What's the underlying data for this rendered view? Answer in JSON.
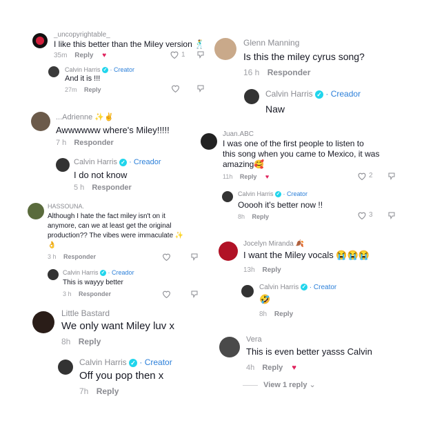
{
  "comments": {
    "c1": {
      "user": "_uncopyrightable_",
      "text": "I like this better than the Miley version",
      "emoji": "🕺",
      "time": "35m",
      "reply": "Reply",
      "likes": "1"
    },
    "c1r": {
      "user": "Calvin Harris",
      "badge": "· Creator",
      "text": "And it is !!!",
      "time": "27m",
      "reply": "Reply"
    },
    "c2": {
      "user": "...Adrienne",
      "emoji_name": "✨✌",
      "text": "Awwwwww where's Miley!!!!!",
      "time": "7 h",
      "reply": "Responder"
    },
    "c2r": {
      "user": "Calvin Harris",
      "badge": "· Creador",
      "text": "I do not know",
      "time": "5 h",
      "reply": "Responder"
    },
    "c3": {
      "user": "HASSOUNA.",
      "text_lines": [
        "Although I hate the fact miley isn't on it",
        "anymore, can we at least get the original",
        "production?? The vibes were immaculate"
      ],
      "emoji": "✨",
      "emoji2": "👌",
      "time": "3 h",
      "reply": "Responder"
    },
    "c3r": {
      "user": "Calvin Harris",
      "badge": "· Creador",
      "text": "This is wayyy better",
      "time": "3 h",
      "reply": "Responder"
    },
    "c4": {
      "user": "Little Bastard",
      "text": "We only want Miley luv x",
      "time": "8h",
      "reply": "Reply"
    },
    "c4r": {
      "user": "Calvin Harris",
      "badge": "· Creator",
      "text": "Off you pop then x",
      "time": "7h",
      "reply": "Reply"
    },
    "c5": {
      "user": "Glenn Manning",
      "text": "Is this the miley cyrus song?",
      "time": "16 h",
      "reply": "Responder"
    },
    "c5r": {
      "user": "Calvin Harris",
      "badge": "· Creador",
      "text": "Naw",
      "time": "",
      "reply": ""
    },
    "c6": {
      "user": "Juan.ABC",
      "text_lines": [
        "I was one of the first people to listen to",
        "this song when you came to Mexico, it was",
        "amazing"
      ],
      "emoji": "🥰",
      "time": "11h",
      "reply": "Reply",
      "likes": "2"
    },
    "c6r": {
      "user": "Calvin Harris",
      "badge": "· Creator",
      "text": "Ooooh it's better now !!",
      "time": "8h",
      "reply": "Reply",
      "likes": "3"
    },
    "c7": {
      "user": "Jocelyn Miranda",
      "emoji_name": "🍂",
      "text": "I want the Miley vocals",
      "emoji": "😭😭😭",
      "time": "13h",
      "reply": "Reply"
    },
    "c7r": {
      "user": "Calvin Harris",
      "badge": "· Creator",
      "text": "🤣",
      "time": "8h",
      "reply": "Reply"
    },
    "c8": {
      "user": "Vera",
      "text": "This is even better yasss Calvin",
      "time": "4h",
      "reply": "Reply",
      "view": "View 1 reply"
    }
  },
  "icons": {
    "heart": "heart-icon",
    "dislike": "dislike-icon",
    "liked_by_creator": "creator-liked-icon",
    "verified": "verified-badge-icon"
  },
  "colors": {
    "creator": "#2b7fd9",
    "meta": "#a1a2a7",
    "text": "#161823",
    "verified": "#20d5ec"
  }
}
